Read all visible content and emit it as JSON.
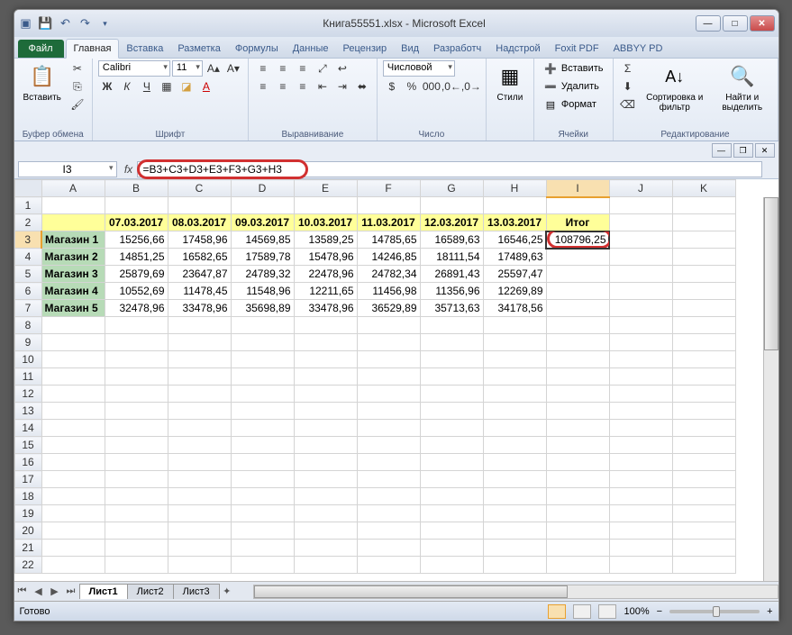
{
  "title": "Книга55551.xlsx - Microsoft Excel",
  "tabs": {
    "file": "Файл",
    "list": [
      "Главная",
      "Вставка",
      "Разметка",
      "Формулы",
      "Данные",
      "Рецензир",
      "Вид",
      "Разработч",
      "Надстрой",
      "Foxit PDF",
      "ABBYY PD"
    ],
    "active": 0
  },
  "ribbon": {
    "clipboard": {
      "paste": "Вставить",
      "label": "Буфер обмена"
    },
    "font": {
      "name": "Calibri",
      "size": "11",
      "label": "Шрифт"
    },
    "align": {
      "label": "Выравнивание"
    },
    "number": {
      "format": "Числовой",
      "label": "Число"
    },
    "styles": {
      "btn": "Стили"
    },
    "cells": {
      "insert": "Вставить",
      "delete": "Удалить",
      "format": "Формат",
      "label": "Ячейки"
    },
    "editing": {
      "sort": "Сортировка и фильтр",
      "find": "Найти и выделить",
      "label": "Редактирование"
    }
  },
  "namebox": "I3",
  "formula": "=B3+C3+D3+E3+F3+G3+H3",
  "columns": [
    "A",
    "B",
    "C",
    "D",
    "E",
    "F",
    "G",
    "H",
    "I",
    "J",
    "K"
  ],
  "headers": [
    "",
    "07.03.2017",
    "08.03.2017",
    "09.03.2017",
    "10.03.2017",
    "11.03.2017",
    "12.03.2017",
    "13.03.2017",
    "Итог"
  ],
  "rows": [
    {
      "label": "Магазин 1",
      "vals": [
        "15256,66",
        "17458,96",
        "14569,85",
        "13589,25",
        "14785,65",
        "16589,63",
        "16546,25",
        "108796,25"
      ]
    },
    {
      "label": "Магазин 2",
      "vals": [
        "14851,25",
        "16582,65",
        "17589,78",
        "15478,96",
        "14246,85",
        "18111,54",
        "17489,63",
        ""
      ]
    },
    {
      "label": "Магазин 3",
      "vals": [
        "25879,69",
        "23647,87",
        "24789,32",
        "22478,96",
        "24782,34",
        "26891,43",
        "25597,47",
        ""
      ]
    },
    {
      "label": "Магазин 4",
      "vals": [
        "10552,69",
        "11478,45",
        "11548,96",
        "12211,65",
        "11456,98",
        "11356,96",
        "12269,89",
        ""
      ]
    },
    {
      "label": "Магазин 5",
      "vals": [
        "32478,96",
        "33478,96",
        "35698,89",
        "33478,96",
        "36529,89",
        "35713,63",
        "34178,56",
        ""
      ]
    }
  ],
  "sheets": [
    "Лист1",
    "Лист2",
    "Лист3"
  ],
  "status": {
    "ready": "Готово",
    "zoom": "100%"
  }
}
